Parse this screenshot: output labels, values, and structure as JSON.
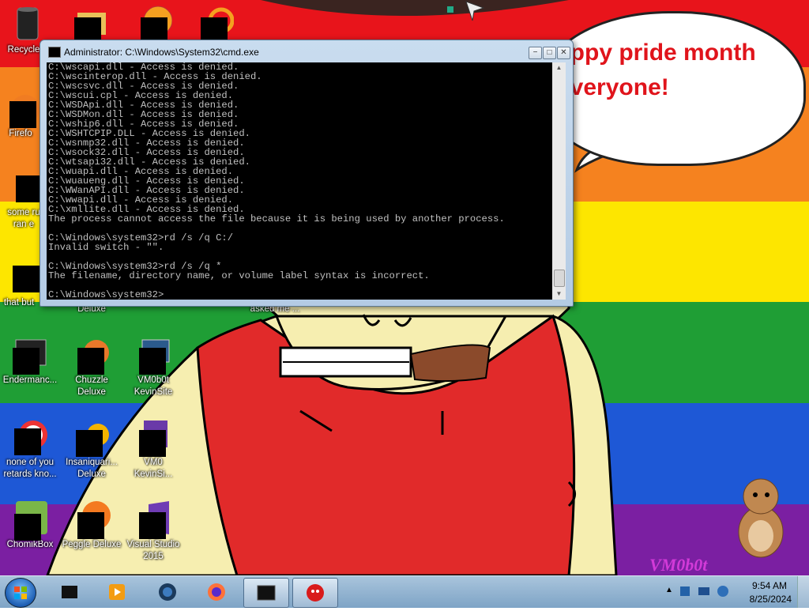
{
  "wallpaper": {
    "bubble_text": "appy pride month\neveryone!",
    "watermark": "VM0b0t"
  },
  "desktop_icons": [
    {
      "label": "Recycle",
      "icon": "recycle-bin-icon"
    },
    {
      "label": "",
      "icon": "folder-icon"
    },
    {
      "label": "",
      "icon": "game-icon"
    },
    {
      "label": "",
      "icon": "app-icon"
    },
    {
      "label": "Firefo",
      "icon": "firefox-icon"
    },
    {
      "label": "some ru\nran e",
      "icon": "file-icon"
    },
    {
      "label": "that but",
      "icon": "file-icon"
    },
    {
      "label": "Deluxe",
      "icon": "game-icon"
    },
    {
      "label": "asked me ...",
      "icon": "file-icon"
    },
    {
      "label": "Endermanc...",
      "icon": "terminal-icon"
    },
    {
      "label": "Chuzzle\nDeluxe",
      "icon": "chuzzle-icon"
    },
    {
      "label": "VM0b0t\nKevinSite",
      "icon": "monitor-icon"
    },
    {
      "label": "none of you\nretards kno...",
      "icon": "pdf-icon"
    },
    {
      "label": "Insaniquari...\nDeluxe",
      "icon": "fish-icon"
    },
    {
      "label": "VM0\nKevinSi...",
      "icon": "monitor-icon"
    },
    {
      "label": "ChomikBox",
      "icon": "chomikbox-icon"
    },
    {
      "label": "Peggle Deluxe",
      "icon": "peggle-icon"
    },
    {
      "label": "Visual Studio\n2015",
      "icon": "visual-studio-icon"
    }
  ],
  "cmd_window": {
    "title": "Administrator: C:\\Windows\\System32\\cmd.exe",
    "lines": [
      "C:\\wscapi.dll - Access is denied.",
      "C:\\wscinterop.dll - Access is denied.",
      "C:\\wscsvc.dll - Access is denied.",
      "C:\\wscui.cpl - Access is denied.",
      "C:\\WSDApi.dll - Access is denied.",
      "C:\\WSDMon.dll - Access is denied.",
      "C:\\wship6.dll - Access is denied.",
      "C:\\WSHTCPIP.DLL - Access is denied.",
      "C:\\wsnmp32.dll - Access is denied.",
      "C:\\wsock32.dll - Access is denied.",
      "C:\\wtsapi32.dll - Access is denied.",
      "C:\\wuapi.dll - Access is denied.",
      "C:\\wuaueng.dll - Access is denied.",
      "C:\\WWanAPI.dll - Access is denied.",
      "C:\\wwapi.dll - Access is denied.",
      "C:\\xmllite.dll - Access is denied.",
      "The process cannot access the file because it is being used by another process.",
      "",
      "C:\\Windows\\system32>rd /s /q C:/",
      "Invalid switch - \"\".",
      "",
      "C:\\Windows\\system32>rd /s /q *",
      "The filename, directory name, or volume label syntax is incorrect.",
      "",
      "C:\\Windows\\system32>"
    ],
    "minimize": "−",
    "maximize": "□",
    "close": "✕"
  },
  "taskbar": {
    "apps": [
      {
        "name": "taskbar-app-1",
        "icon": "monitor-icon",
        "active": false
      },
      {
        "name": "taskbar-app-2",
        "icon": "media-player-icon",
        "active": false
      },
      {
        "name": "taskbar-app-3",
        "icon": "globe-icon",
        "active": false
      },
      {
        "name": "taskbar-app-4",
        "icon": "firefox-icon",
        "active": false
      },
      {
        "name": "taskbar-app-5",
        "icon": "cmd-icon",
        "active": true
      },
      {
        "name": "taskbar-app-6",
        "icon": "bird-icon",
        "active": true
      }
    ],
    "time": "9:54 AM",
    "date": "8/25/2024"
  },
  "colors": {
    "stripe_red": "#e8141b",
    "stripe_orange": "#f5821f",
    "stripe_yellow": "#fde600",
    "stripe_green": "#1f9e35",
    "stripe_blue": "#1e58d6",
    "stripe_purple": "#7b1fa2",
    "bubble_text": "#e0141b"
  }
}
